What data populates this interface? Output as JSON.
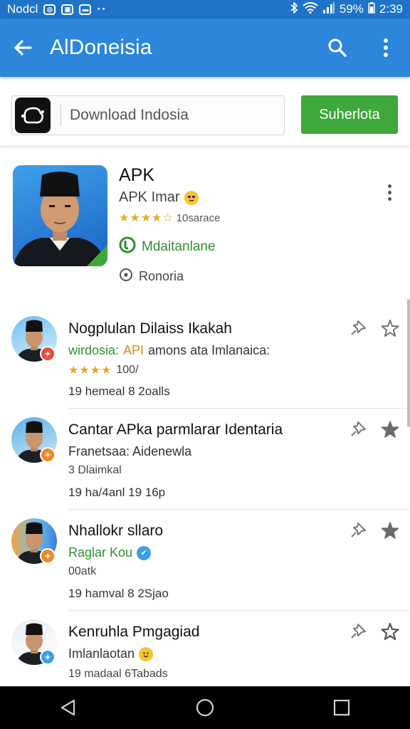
{
  "status_bar": {
    "carrier": "Nodcl",
    "battery": "59%",
    "time": "2:39"
  },
  "app_bar": {
    "title": "AlDoneisia",
    "icons": [
      "back-arrow-icon",
      "search-icon",
      "more-vert-icon"
    ]
  },
  "search": {
    "text": "Download Indosia",
    "button_label": "Suherlota"
  },
  "featured_app": {
    "title": "APK",
    "subtitle": "APK Imar",
    "rating_text": "10sarace",
    "install_label": "Mdaitanlane",
    "location_label": "Ronoria"
  },
  "list_items": [
    {
      "title": "Nogplulan Dilaiss Ikakah",
      "line2_prefix": "wirdosia:",
      "line2_highlight": "API",
      "line2_suffix": "amons ata Imlanaica:",
      "rating_count": "100/",
      "line4": "19 hemeal 8 2oalls",
      "badge_color": "#e84c3d",
      "star_filled": false
    },
    {
      "title": "Cantar APka parmlarar Identaria",
      "line2": "Franetsaa: Aidenewla",
      "line3": "3 Dlaimkal",
      "line4": "19 ha/4anl 19 16p",
      "badge_color": "#f08a24",
      "star_filled": true
    },
    {
      "title": "Nhallokr sllaro",
      "line2": "Raglar Kou",
      "line3": "00atk",
      "line4": "19 hamval 8 2Sjao",
      "badge_color": "#f08a24",
      "star_filled": true
    },
    {
      "title": "Kenruhla Pmgagiad",
      "line2": "Imlanlaotan",
      "line4": "19 madaal 6Tabads",
      "badge_color": "#3ba0e6",
      "star_filled": false
    }
  ],
  "colors": {
    "status_bar": "#1f73c8",
    "app_bar": "#2b86dc",
    "accent_green": "#3fa83a",
    "star_gold": "#e5ab1e"
  }
}
